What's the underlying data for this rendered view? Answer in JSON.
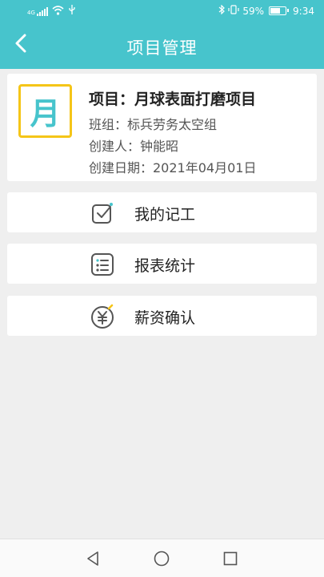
{
  "status_bar": {
    "signal_label": "4G",
    "battery": "59%",
    "time": "9:34"
  },
  "header": {
    "title": "项目管理",
    "back_icon": "chevron-left-icon"
  },
  "project": {
    "badge": "月",
    "title": "项目：月球表面打磨项目",
    "team": "班组：标兵劳务太空组",
    "creator": "创建人：钟能昭",
    "created_date": "创建日期：2021年04月01日"
  },
  "menu": [
    {
      "label": "我的记工",
      "icon": "check-calendar-icon"
    },
    {
      "label": "报表统计",
      "icon": "list-report-icon"
    },
    {
      "label": "薪资确认",
      "icon": "yuan-coin-icon"
    }
  ],
  "colors": {
    "accent": "#47c4cc",
    "badge_border": "#f5c518",
    "icon_gray": "#555555"
  }
}
